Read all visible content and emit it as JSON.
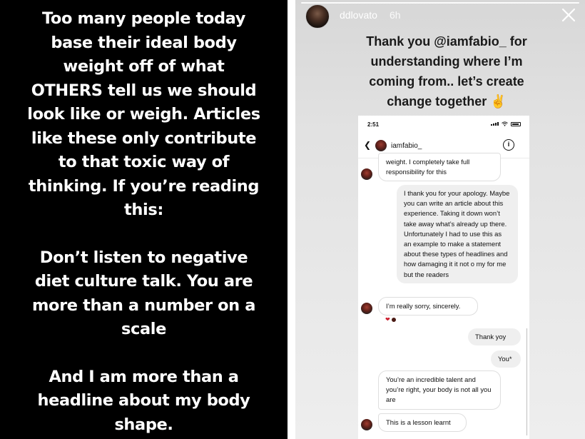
{
  "left_story": {
    "paragraphs": [
      {
        "lines": [
          "Too many people today",
          "base their ideal body",
          "weight off of what",
          "OTHERS tell us we should",
          "look like or weigh. Articles",
          "like these only contribute",
          "to that toxic way of",
          "thinking. If you’re reading",
          "this:"
        ]
      },
      {
        "lines": [
          "Don’t listen to negative",
          "diet culture talk. You are",
          "more than a number on a",
          "scale"
        ]
      },
      {
        "lines": [
          "And I am more than a",
          "headline about my body",
          "shape."
        ]
      }
    ]
  },
  "right_story": {
    "username": "ddlovato",
    "time_ago": "6h",
    "close_icon": "close-icon",
    "caption_lines": [
      "Thank you @iamfabio_ for",
      "understanding where I’m",
      "coming from.. let’s create",
      "change together ✌️"
    ],
    "phone": {
      "status_time": "2:51",
      "chat": {
        "contact_name": "iamfabio_",
        "messages": [
          {
            "sender": "them",
            "text": "weight. I completely take full responsibility for this"
          },
          {
            "sender": "me",
            "text": "I thank you for your apology. Maybe you can write an article about this experience. Taking it down won’t take away what’s already up there. Unfortunately I had to use this as an example to make a statement about these types of headlines and how damaging it it not o my for me but the readers"
          },
          {
            "sender": "them",
            "text": "I’m really sorry, sincerely.",
            "reaction": "❤"
          },
          {
            "sender": "me",
            "text": "Thank yoy"
          },
          {
            "sender": "me",
            "text": "You*"
          },
          {
            "sender": "them",
            "text": "You’re an incredible talent and you’re right, your body is not all you are"
          },
          {
            "sender": "them",
            "text": "This is a lesson learnt"
          }
        ]
      }
    }
  }
}
